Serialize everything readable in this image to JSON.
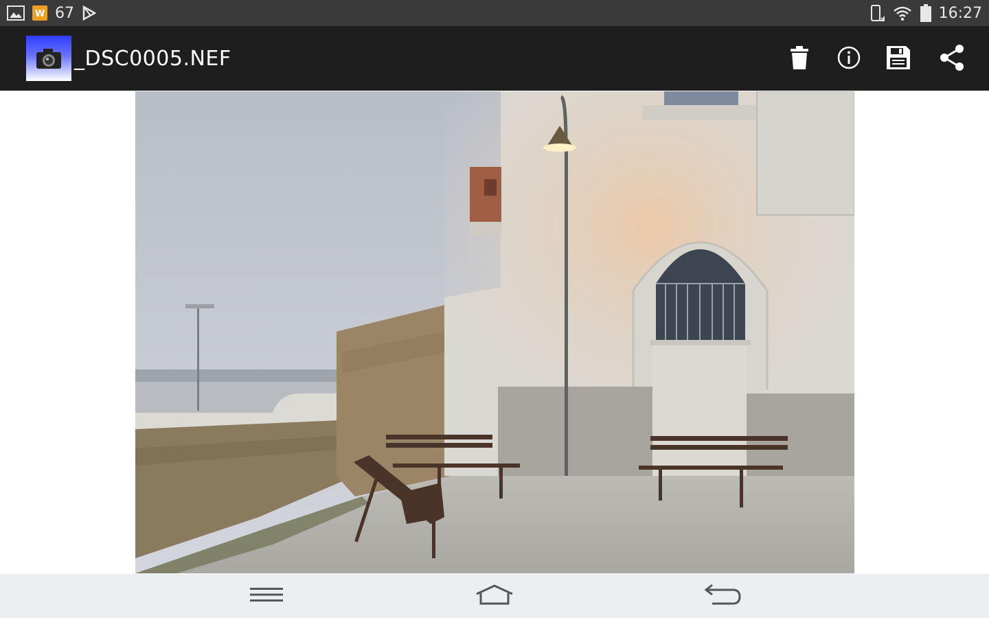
{
  "status_bar": {
    "notification_count": "67",
    "time": "16:27",
    "left_icons": [
      "gallery-icon",
      "app-notification-icon",
      "play-store-icon"
    ],
    "right_icons": [
      "rotate-icon",
      "wifi-icon",
      "battery-icon"
    ]
  },
  "action_bar": {
    "title": "_DSC0005.NEF",
    "app_icon": "camera-icon",
    "actions": [
      "delete-icon",
      "info-icon",
      "save-icon",
      "share-icon"
    ]
  },
  "photo": {
    "subject": "photo-viewer-image"
  },
  "nav_bar": {
    "buttons": [
      "menu-icon",
      "home-icon",
      "back-icon"
    ]
  },
  "colors": {
    "status_bar_bg": "#3a3a3a",
    "action_bar_bg": "#1e1e1e",
    "nav_bar_bg": "#eceff1",
    "app_icon_blue": "#2f3cff"
  }
}
